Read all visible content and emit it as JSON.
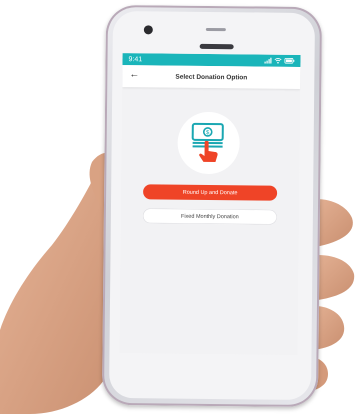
{
  "status_bar": {
    "time": "9:41",
    "icons": [
      "signal-icon",
      "wifi-icon",
      "battery-icon"
    ]
  },
  "header": {
    "back_icon": "back-arrow-icon",
    "title": "Select Donation Option"
  },
  "illustration": {
    "icon": "cash-hand-tap-icon"
  },
  "buttons": {
    "round_up": "Round Up and Donate",
    "fixed_monthly": "Fixed Monthly Donation"
  },
  "colors": {
    "status_bar": "#1ab5ba",
    "primary_button": "#ef4427",
    "screen_bg": "#f2f2f4",
    "icon_teal": "#1aa7b2",
    "icon_red": "#ef4427"
  }
}
